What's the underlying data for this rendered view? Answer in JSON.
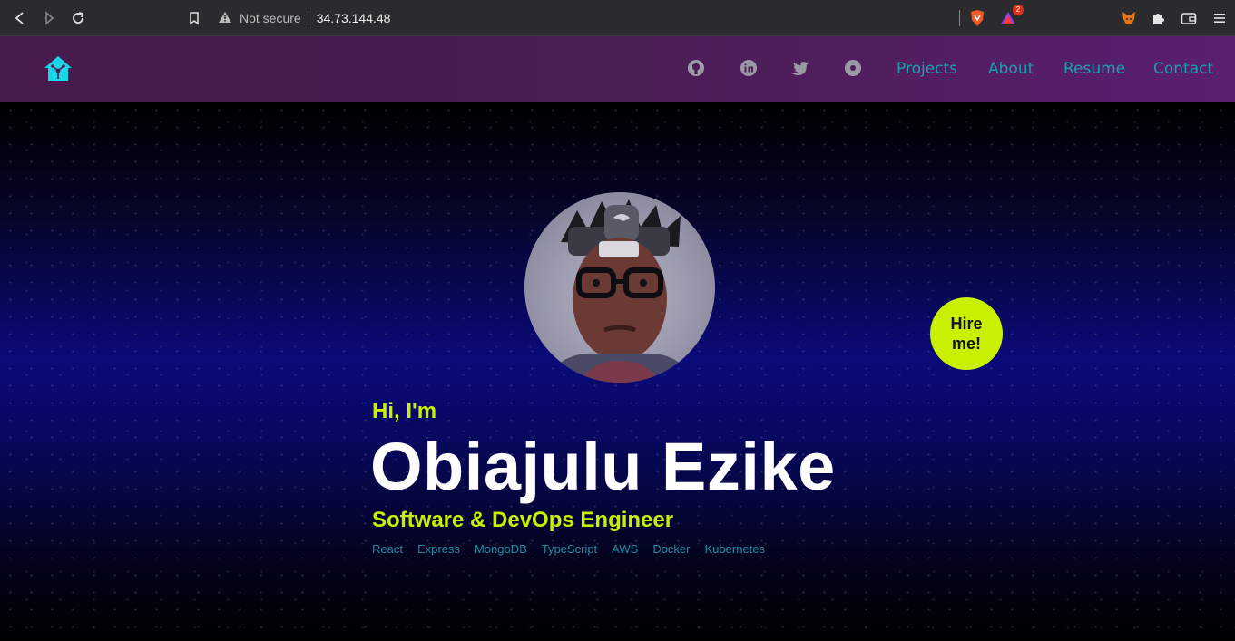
{
  "browser": {
    "security_label": "Not secure",
    "url": "34.73.144.48",
    "brave_badge": "2"
  },
  "nav": {
    "links": [
      "Projects",
      "About",
      "Resume",
      "Contact"
    ],
    "social_icons": [
      "github-icon",
      "linkedin-icon",
      "twitter-icon",
      "portfolio-icon"
    ]
  },
  "hero": {
    "greeting": "Hi, I'm",
    "name": "Obiajulu Ezike",
    "role": "Software & DevOps Engineer",
    "skills": [
      "React",
      "Express",
      "MongoDB",
      "TypeScript",
      "AWS",
      "Docker",
      "Kubernetes"
    ],
    "hire_label": "Hire me!"
  },
  "colors": {
    "accent": "#c8f000",
    "link": "#1aa0ad",
    "nav_bg": "#4a1d54"
  }
}
